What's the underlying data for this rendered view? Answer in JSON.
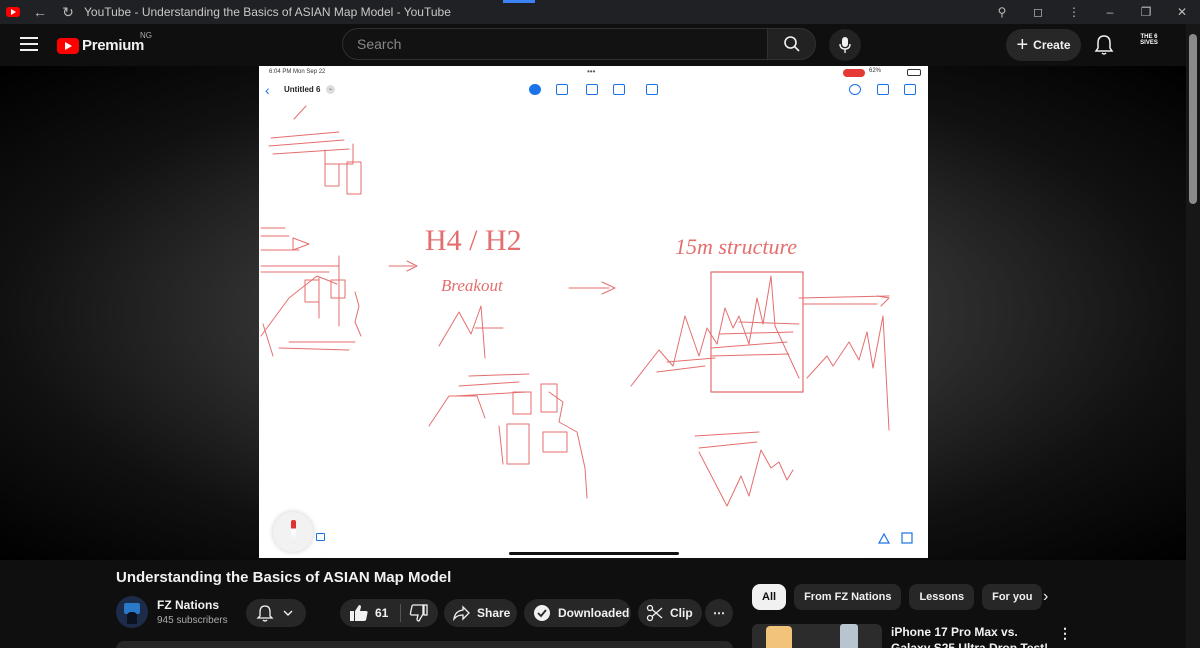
{
  "window": {
    "tab_title": "YouTube - Understanding the Basics of ASIAN Map Model - YouTube"
  },
  "header": {
    "logo_text": "Premium",
    "country_code": "NG",
    "search_placeholder": "Search",
    "create_label": "Create",
    "account_badge": "THE 6 SIVES"
  },
  "video_frame": {
    "status_time": "6:04 PM  Mon Sep 22",
    "battery": "62%",
    "document_title": "Untitled 6",
    "notes": {
      "h4_h2": "H4 / H2",
      "breakout": "Breakout",
      "structure": "15m structure"
    }
  },
  "video": {
    "title": "Understanding the Basics of ASIAN Map Model",
    "channel_name": "FZ Nations",
    "subscribers": "945 subscribers",
    "likes": "61",
    "share_label": "Share",
    "downloaded_label": "Downloaded",
    "clip_label": "Clip"
  },
  "chips": [
    "All",
    "From FZ Nations",
    "Lessons",
    "For you"
  ],
  "recommendation": {
    "title": "iPhone 17 Pro Max vs. Galaxy S25 Ultra Drop Test!"
  },
  "colors": {
    "accent_red": "#ff0000",
    "ink_red": "#e05555",
    "ipad_blue": "#1a73e8"
  }
}
